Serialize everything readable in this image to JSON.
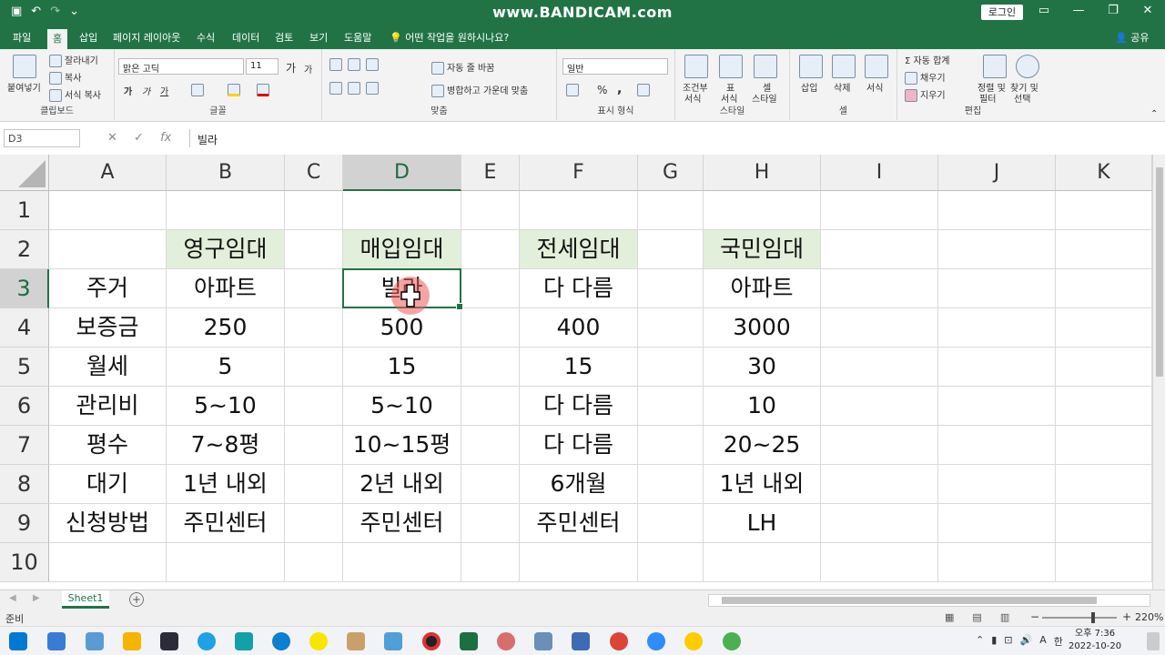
{
  "title_bar": {
    "title": "www.BANDICAM.com",
    "login_label": "로그인",
    "quick_access": [
      "save-icon",
      "undo-icon",
      "redo-icon",
      "customize-icon"
    ],
    "window_controls": [
      "ribbon-display-icon",
      "minimize-icon",
      "restore-icon",
      "close-icon"
    ]
  },
  "menu": {
    "tabs": [
      "파일",
      "홈",
      "삽입",
      "페이지 레이아웃",
      "수식",
      "데이터",
      "검토",
      "보기",
      "도움말"
    ],
    "active_tab": "홈",
    "tell_me": "어떤 작업을 원하시나요?",
    "share": "공유"
  },
  "ribbon": {
    "clipboard": {
      "paste": "붙여넣기",
      "cut": "잘라내기",
      "copy": "복사",
      "format_painter": "서식 복사",
      "label": "클립보드"
    },
    "font": {
      "name": "맑은 고딕",
      "size": "11",
      "bold": "가",
      "italic": "가",
      "underline": "가",
      "grow": "가",
      "shrink": "가",
      "label": "글꼴"
    },
    "alignment": {
      "wrap": "자동 줄 바꿈",
      "merge": "병합하고 가운데 맞춤",
      "label": "맞춤"
    },
    "number": {
      "format": "일반",
      "percent": "%",
      "comma": ",",
      "label": "표시 형식"
    },
    "styles": {
      "conditional": "조건부",
      "conditional2": "서식",
      "table": "표",
      "table2": "서식",
      "cell": "셀",
      "cell2": "스타일",
      "label": "스타일"
    },
    "cells": {
      "insert": "삽입",
      "delete": "삭제",
      "format": "서식",
      "label": "셀"
    },
    "editing": {
      "autosum": "자동 합계",
      "fill": "채우기",
      "clear": "지우기",
      "sort": "정렬 및",
      "sort2": "필터",
      "find": "찾기 및",
      "find2": "선택",
      "label": "편집"
    }
  },
  "formula_bar": {
    "name_box": "D3",
    "cancel": "✕",
    "enter": "✓",
    "fx": "fx",
    "content": "빌라"
  },
  "grid": {
    "columns": [
      "A",
      "B",
      "C",
      "D",
      "E",
      "F",
      "G",
      "H",
      "I",
      "J",
      "K"
    ],
    "rows": [
      "1",
      "2",
      "3",
      "4",
      "5",
      "6",
      "7",
      "8",
      "9",
      "10"
    ],
    "selected_column": "D",
    "selected_row": "3",
    "cells": {
      "B2": "영구임대",
      "D2": "매입임대",
      "F2": "전세임대",
      "H2": "국민임대",
      "A3": "주거",
      "B3": "아파트",
      "D3": "빌라",
      "F3": "다 다름",
      "H3": "아파트",
      "A4": "보증금",
      "B4": "250",
      "D4": "500",
      "F4": "400",
      "H4": "3000",
      "A5": "월세",
      "B5": "5",
      "D5": "15",
      "F5": "15",
      "H5": "30",
      "A6": "관리비",
      "B6": "5~10",
      "D6": "5~10",
      "F6": "다 다름",
      "H6": "10",
      "A7": "평수",
      "B7": "7~8평",
      "D7": "10~15평",
      "F7": "다 다름",
      "H7": "20~25",
      "A8": "대기",
      "B8": "1년 내외",
      "D8": "2년 내외",
      "F8": "6개월",
      "H8": "1년 내외",
      "A9": "신청방법",
      "B9": "주민센터",
      "D9": "주민센터",
      "F9": "주민센터",
      "H9": "LH"
    },
    "highlight_color": "#e2efda"
  },
  "sheets": {
    "tabs": [
      "Sheet1"
    ],
    "add": "+"
  },
  "status": {
    "ready": "준비",
    "zoom": "220%",
    "zoom_out": "−",
    "zoom_in": "+"
  },
  "taskbar": {
    "time": "오후 7:36",
    "date": "2022-10-20",
    "ime": "한",
    "ime_letter": "A",
    "accent": "#217346"
  }
}
